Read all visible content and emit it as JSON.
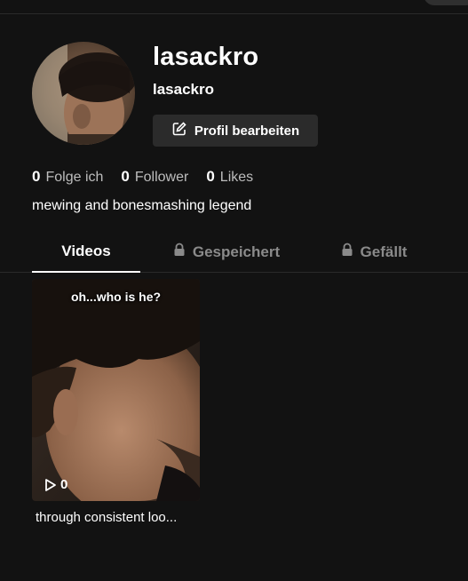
{
  "profile": {
    "title": "lasackro",
    "handle": "lasackro",
    "edit_label": "Profil bearbeiten",
    "bio": "mewing and bonesmashing legend"
  },
  "stats": [
    {
      "value": "0",
      "label": "Folge ich"
    },
    {
      "value": "0",
      "label": "Follower"
    },
    {
      "value": "0",
      "label": "Likes"
    }
  ],
  "tabs": [
    {
      "label": "Videos",
      "locked": false,
      "active": true
    },
    {
      "label": "Gespeichert",
      "locked": true,
      "active": false
    },
    {
      "label": "Gefällt",
      "locked": true,
      "active": false
    }
  ],
  "videos": [
    {
      "overlay_text": "oh...who is he?",
      "plays": "0",
      "caption": "through consistent loo..."
    }
  ],
  "icons": {
    "edit": "edit-icon",
    "lock": "lock-icon",
    "play": "play-icon"
  },
  "colors": {
    "background": "#121212",
    "button": "#2b2b2b",
    "muted_text": "#8a8a8a"
  }
}
